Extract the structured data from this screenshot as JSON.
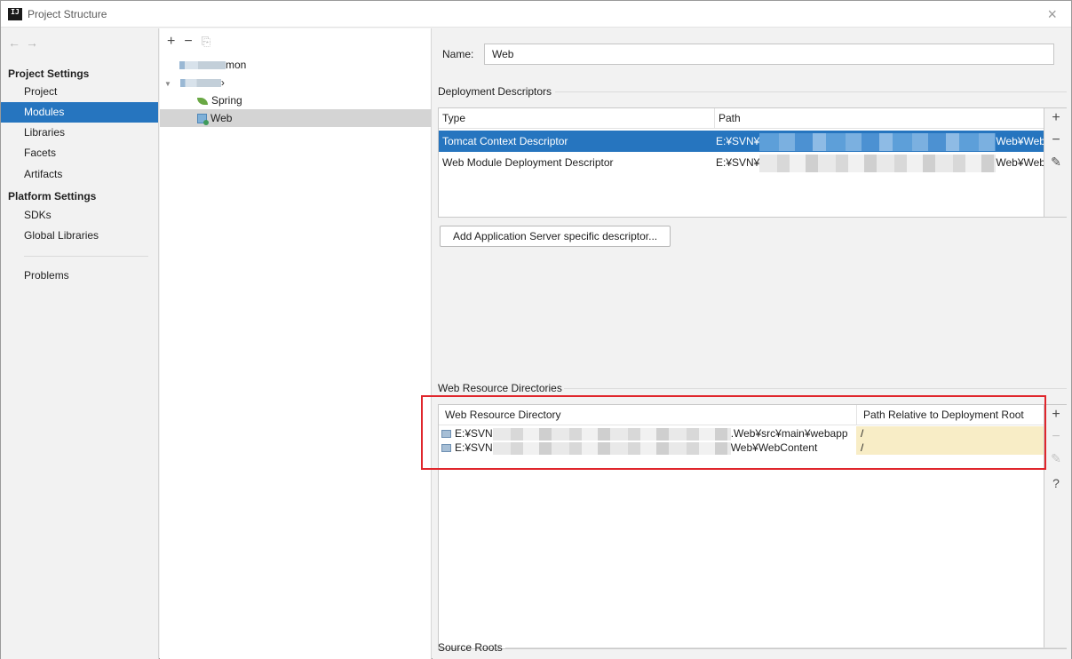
{
  "window": {
    "title": "Project Structure",
    "app_icon_text": "IJ",
    "close_glyph": "×"
  },
  "sidebar": {
    "nav_back": "←",
    "nav_forward": "→",
    "project_settings_label": "Project Settings",
    "project_items": [
      "Project",
      "Modules",
      "Libraries",
      "Facets",
      "Artifacts"
    ],
    "selected_item": "Modules",
    "platform_settings_label": "Platform Settings",
    "platform_items": [
      "SDKs",
      "Global Libraries"
    ],
    "problems_label": "Problems"
  },
  "module_tree": {
    "toolbar": {
      "add": "+",
      "remove": "−",
      "copy": "⎘"
    },
    "items": [
      {
        "label": "mon",
        "kind": "module-obscured"
      },
      {
        "label": "›",
        "kind": "module-obscured-expanded"
      },
      {
        "label": "Spring",
        "kind": "facet-spring"
      },
      {
        "label": "Web",
        "kind": "facet-web",
        "selected": true
      }
    ]
  },
  "content": {
    "name_label": "Name:",
    "name_value": "Web",
    "deployment_descriptors_title": "Deployment Descriptors",
    "descriptor_headers": [
      "Type",
      "Path"
    ],
    "descriptors": [
      {
        "type": "Tomcat Context Descriptor",
        "path_start": "E:¥SVN¥",
        "path_end": "Web¥Web(",
        "selected": true
      },
      {
        "type": "Web Module Deployment Descriptor",
        "path_start": "E:¥SVN¥",
        "path_end": "Web¥Web(",
        "selected": false
      }
    ],
    "add_server_descriptor_button": "Add Application Server specific descriptor...",
    "web_resource_title": "Web Resource Directories",
    "resource_headers": [
      "Web Resource Directory",
      "Path Relative to Deployment Root"
    ],
    "resources": [
      {
        "dir_start": "E:¥SVN",
        "dir_end": ".Web¥src¥main¥webapp",
        "relative": "/"
      },
      {
        "dir_start": "E:¥SVN",
        "dir_end": "Web¥WebContent",
        "relative": "/"
      }
    ],
    "source_roots_title": "Source Roots",
    "tools": {
      "add": "+",
      "remove": "−",
      "edit": "✎",
      "help": "?"
    }
  },
  "colors": {
    "selection": "#2675bf",
    "highlight_box": "#e0262c",
    "relative_path_bg": "#f8edc6"
  }
}
